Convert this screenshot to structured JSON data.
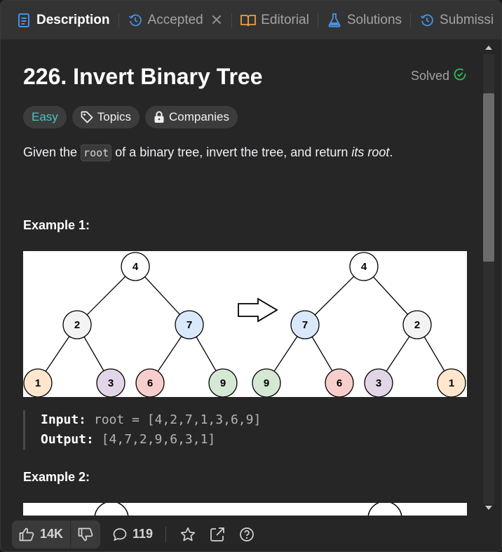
{
  "tabs": [
    {
      "label": "Description",
      "icon": "description-icon"
    },
    {
      "label": "Accepted",
      "icon": "history-icon"
    },
    {
      "label": "Editorial",
      "icon": "book-icon"
    },
    {
      "label": "Solutions",
      "icon": "flask-icon"
    },
    {
      "label": "Submissi",
      "icon": "history-icon"
    }
  ],
  "problem": {
    "title": "226. Invert Binary Tree",
    "status": "Solved",
    "difficulty": "Easy",
    "topics_label": "Topics",
    "companies_label": "Companies",
    "desc_before": "Given the ",
    "desc_code": "root",
    "desc_mid": " of a binary tree, invert the tree, and return ",
    "desc_em": "its root",
    "desc_end": "."
  },
  "example1": {
    "heading": "Example 1:",
    "input_label": "Input:",
    "input_value": "root = [4,2,7,1,3,6,9]",
    "output_label": "Output:",
    "output_value": "[4,7,2,9,6,3,1]",
    "left_tree": {
      "root": "4",
      "l": "2",
      "r": "7",
      "ll": "1",
      "lr": "3",
      "rl": "6",
      "rr": "9"
    },
    "right_tree": {
      "root": "4",
      "l": "7",
      "r": "2",
      "ll": "9",
      "lr": "6",
      "rl": "3",
      "rr": "1"
    }
  },
  "example2": {
    "heading": "Example 2:"
  },
  "bottom": {
    "likes": "14K",
    "comments": "119"
  },
  "colors": {
    "accent_easy": "#46c6c2",
    "solved_check": "#2cbb5d",
    "node_white": "#ffffff",
    "node_gray": "#f3f3f3",
    "node_blue": "#dae8fc",
    "node_peach": "#ffe6cc",
    "node_purple": "#e1d5e7",
    "node_red": "#f8cecc",
    "node_green": "#d5e8d4"
  }
}
